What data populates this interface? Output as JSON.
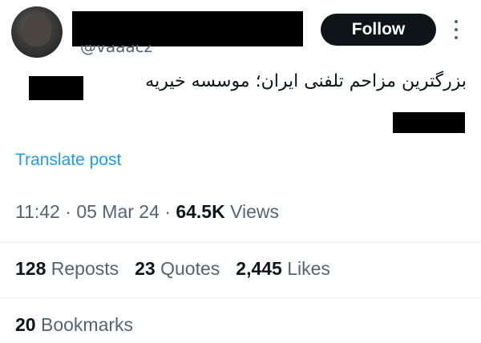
{
  "author": {
    "handle": "@vaaacz"
  },
  "follow_button": {
    "label": "Follow"
  },
  "post": {
    "text": "بزرگترین مزاحم تلفنی ایران؛ موسسه خیریه"
  },
  "translate": {
    "label": "Translate post"
  },
  "meta": {
    "time": "11:42",
    "separator": "·",
    "date": "05 Mar 24",
    "views_count": "64.5K",
    "views_label": "Views"
  },
  "stats": {
    "reposts_count": "128",
    "reposts_label": "Reposts",
    "quotes_count": "23",
    "quotes_label": "Quotes",
    "likes_count": "2,445",
    "likes_label": "Likes",
    "bookmarks_count": "20",
    "bookmarks_label": "Bookmarks"
  },
  "icons": {
    "more": "more-dots-vertical-icon"
  },
  "colors": {
    "text_primary": "#0f1419",
    "text_secondary": "#536471",
    "link": "#1d9bf0",
    "button_bg": "#0f1419",
    "button_text": "#ffffff",
    "redaction": "#000000"
  }
}
